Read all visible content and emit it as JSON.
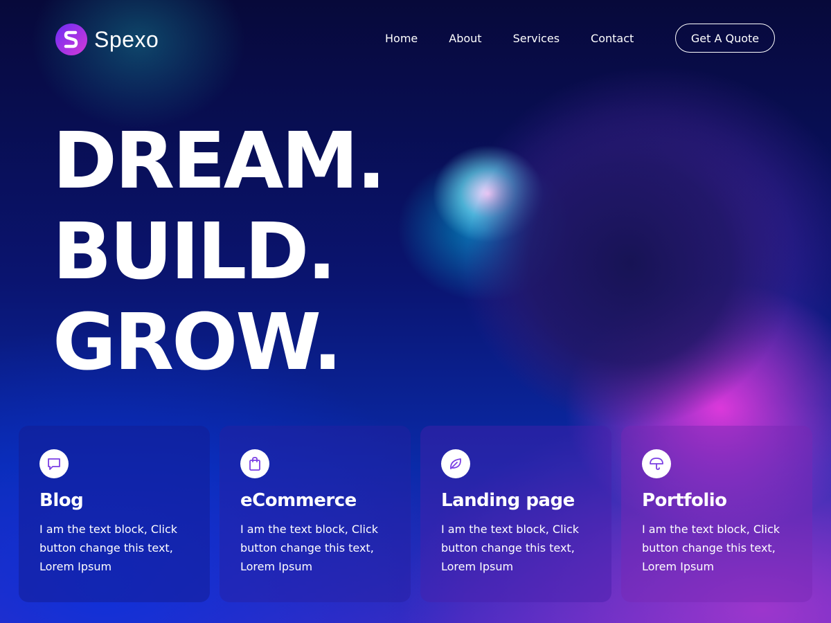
{
  "brand": {
    "name": "Spexo",
    "logo_icon": "spexo-logo-icon"
  },
  "nav": {
    "items": [
      {
        "label": "Home"
      },
      {
        "label": "About"
      },
      {
        "label": "Services"
      },
      {
        "label": "Contact"
      }
    ],
    "cta_label": "Get A Quote"
  },
  "hero": {
    "lines": [
      "DREAM.",
      "BUILD.",
      "GROW."
    ]
  },
  "cards": [
    {
      "icon": "chat-bubble-icon",
      "title": "Blog",
      "text": "I am the text block, Click button change this text, Lorem Ipsum"
    },
    {
      "icon": "shopping-bag-icon",
      "title": "eCommerce",
      "text": "I am the text block, Click button change this text, Lorem Ipsum"
    },
    {
      "icon": "leaf-icon",
      "title": "Landing page",
      "text": "I am the text block, Click button change this text, Lorem Ipsum"
    },
    {
      "icon": "umbrella-icon",
      "title": "Portfolio",
      "text": "I am the text block, Click button change this text, Lorem Ipsum"
    }
  ],
  "colors": {
    "accent_purple": "#6a2cf5",
    "accent_pink": "#d63ad6",
    "icon_stroke": "#7b3fe4",
    "background_dark": "#0a0d45"
  }
}
